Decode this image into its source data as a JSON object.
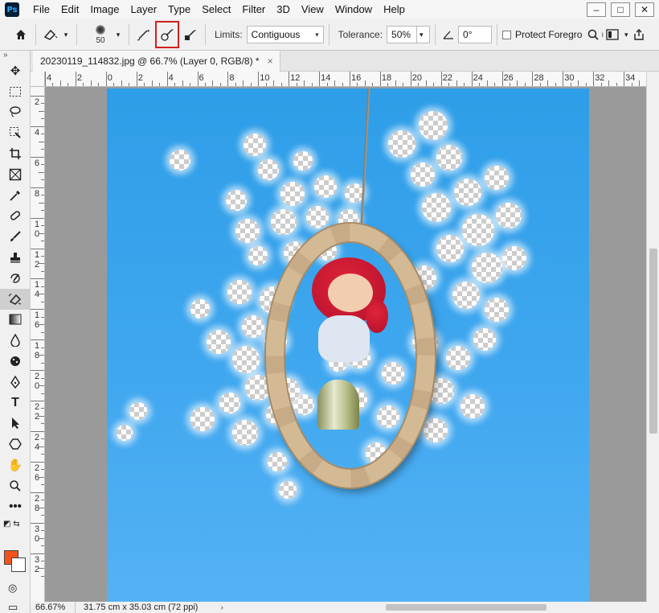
{
  "menubar": {
    "logo": "Ps",
    "items": [
      "File",
      "Edit",
      "Image",
      "Layer",
      "Type",
      "Select",
      "Filter",
      "3D",
      "View",
      "Window",
      "Help"
    ],
    "window_controls": [
      "–",
      "□",
      "✕"
    ]
  },
  "options": {
    "brush_size": "50",
    "limits_label": "Limits:",
    "limits_value": "Contiguous",
    "tolerance_label": "Tolerance:",
    "tolerance_value": "50%",
    "angle_value": "0°",
    "protect_label": "Protect Foregro",
    "extra": "ı"
  },
  "document": {
    "tab_title": "20230119_114832.jpg @ 66.7% (Layer 0, RGB/8) *",
    "close": "×"
  },
  "rulers": {
    "horizontal": [
      "4",
      "2",
      "0",
      "2",
      "4",
      "6",
      "8",
      "10",
      "12",
      "14",
      "16",
      "18",
      "20",
      "22",
      "24",
      "26",
      "28",
      "30",
      "32",
      "34"
    ],
    "vertical": [
      "2",
      "4",
      "6",
      "8",
      "1 0",
      "1 2",
      "1 4",
      "1 6",
      "1 8",
      "2 0",
      "2 2",
      "2 4",
      "2 6",
      "2 8",
      "3 0",
      "3 2"
    ]
  },
  "tools_panel": {
    "header": "»"
  },
  "colors": {
    "foreground": "#f2531c",
    "background": "#ffffff"
  },
  "status": {
    "zoom": "66.67%",
    "doc_size": "31.75 cm x 35.03 cm (72 ppi)",
    "arrow": "›"
  }
}
